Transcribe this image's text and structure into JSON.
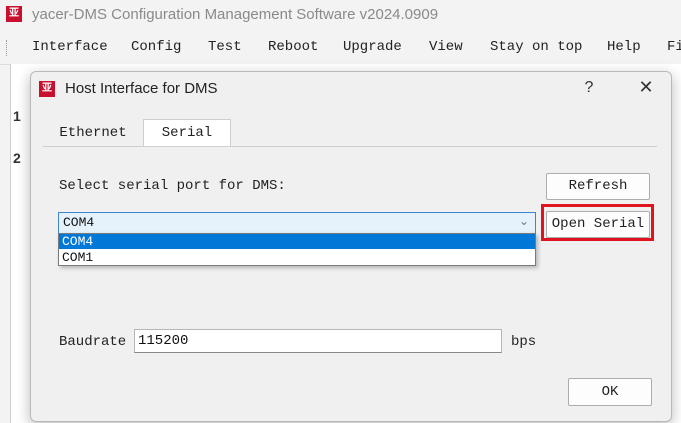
{
  "app": {
    "logo_text": "亚",
    "title": "yacer-DMS Configuration Management Software v2024.0909"
  },
  "menu": {
    "items": [
      "Interface",
      "Config",
      "Test",
      "Reboot",
      "Upgrade",
      "View",
      "Stay on top",
      "Help",
      "Fi"
    ]
  },
  "grid": {
    "row_headers": [
      "1",
      "2"
    ]
  },
  "dialog": {
    "logo_text": "亚",
    "title": "Host Interface for DMS",
    "help_glyph": "?",
    "close_glyph": "✕",
    "tabs": [
      "Ethernet",
      "Serial"
    ],
    "active_tab": "Serial",
    "select_label": "Select serial port for DMS:",
    "refresh_label": "Refresh",
    "open_serial_label": "Open Serial",
    "port_combo": {
      "value": "COM4",
      "options": [
        "COM4",
        "COM1"
      ],
      "arrow_icon": "chevron-down-icon"
    },
    "baud_label": "Baudrate",
    "baud_value": "115200",
    "baud_unit": "bps",
    "ok_label": "OK",
    "highlight_color": "#e0141e",
    "accent_color": "#0078d7"
  }
}
